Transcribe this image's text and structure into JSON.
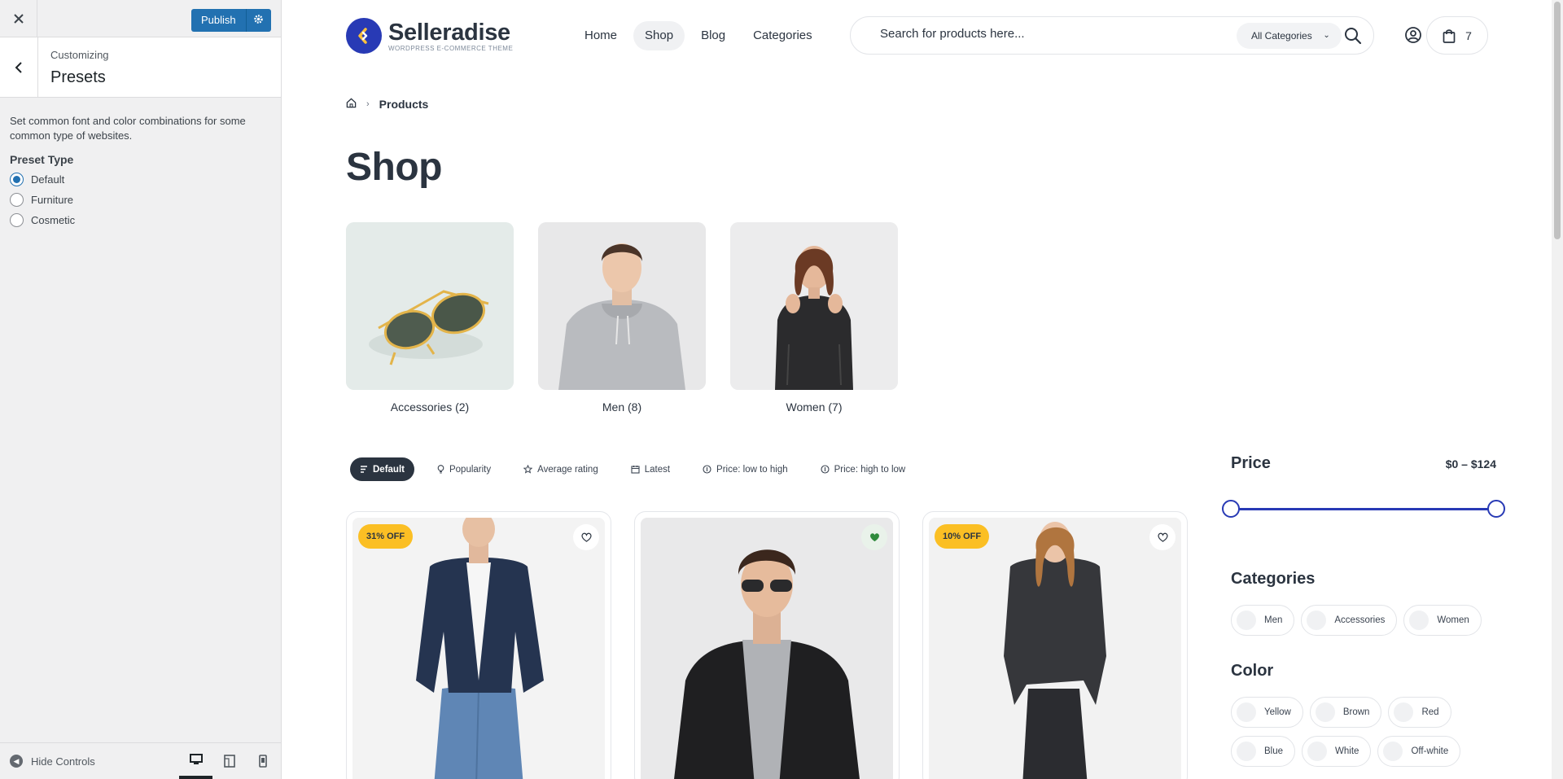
{
  "customizer": {
    "close_label": "×",
    "publish_label": "Publish",
    "breadcrumb": "Customizing",
    "section_title": "Presets",
    "description": "Set common font and color combinations for some common type of websites.",
    "preset_label": "Preset Type",
    "presets": [
      {
        "label": "Default",
        "selected": true
      },
      {
        "label": "Furniture",
        "selected": false
      },
      {
        "label": "Cosmetic",
        "selected": false
      }
    ],
    "hide_controls": "Hide Controls",
    "devices": [
      "desktop",
      "tablet",
      "mobile"
    ]
  },
  "site": {
    "brand": {
      "name": "Selleradise",
      "tagline": "WORDPRESS E-COMMERCE THEME",
      "accent": "#283ab5",
      "highlight": "#fcc13c"
    },
    "nav": [
      {
        "label": "Home",
        "active": false
      },
      {
        "label": "Shop",
        "active": true
      },
      {
        "label": "Blog",
        "active": false
      },
      {
        "label": "Categories",
        "active": false
      }
    ],
    "search": {
      "placeholder": "Search for products here...",
      "category": "All Categories"
    },
    "cart_count": "7",
    "breadcrumb": {
      "current": "Products"
    },
    "page_title": "Shop",
    "categories": [
      {
        "name": "Accessories",
        "count": "(2)"
      },
      {
        "name": "Men",
        "count": "(8)"
      },
      {
        "name": "Women",
        "count": "(7)"
      }
    ],
    "sort_options": [
      {
        "label": "Default",
        "active": true,
        "icon": "sort-icon"
      },
      {
        "label": "Popularity",
        "active": false,
        "icon": "bulb-icon"
      },
      {
        "label": "Average rating",
        "active": false,
        "icon": "star-icon"
      },
      {
        "label": "Latest",
        "active": false,
        "icon": "calendar-icon"
      },
      {
        "label": "Price: low to high",
        "active": false,
        "icon": "coin-icon"
      },
      {
        "label": "Price: high to low",
        "active": false,
        "icon": "coin-icon"
      }
    ],
    "products": [
      {
        "badge": "31% OFF",
        "wishlisted": false
      },
      {
        "badge": "",
        "wishlisted": true
      },
      {
        "badge": "10% OFF",
        "wishlisted": false
      }
    ],
    "filters": {
      "price_title": "Price",
      "price_min": "$0",
      "price_sep": "–",
      "price_max": "$124",
      "categories_title": "Categories",
      "categories": [
        "Men",
        "Accessories",
        "Women"
      ],
      "color_title": "Color",
      "colors": [
        "Yellow",
        "Brown",
        "Red",
        "Blue",
        "White",
        "Off-white"
      ]
    }
  }
}
